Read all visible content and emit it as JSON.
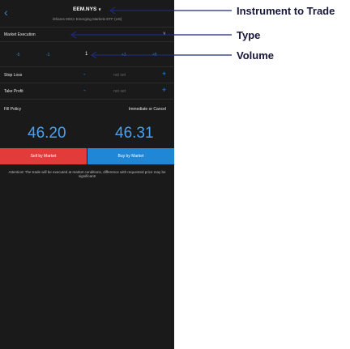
{
  "header": {
    "back_icon": "chevron-left-icon",
    "title": "EEM.NYS",
    "title_chevron": "∨",
    "subtitle": "iShares MSCI Emerging Markets ETF (US)"
  },
  "type_row": {
    "label": "Market Execution",
    "chevron": "∨"
  },
  "volume_row": {
    "steps_left": [
      "-5",
      "-1"
    ],
    "value": "1",
    "steps_right": [
      "+1",
      "+5"
    ]
  },
  "stop_loss": {
    "label": "Stop Loss",
    "minus": "-",
    "value": "not set",
    "plus": "+"
  },
  "take_profit": {
    "label": "Take Profit",
    "minus": "-",
    "value": "not set",
    "plus": "+"
  },
  "fill_policy": {
    "label": "Fill Policy",
    "value": "Immediate or Cancel"
  },
  "prices": {
    "sell": "46.20",
    "buy": "46.31"
  },
  "buttons": {
    "sell": "Sell by Market",
    "buy": "Buy by Market"
  },
  "note": "Attention! The trade will be executed at market conditions, difference with requested price may be significant!",
  "annotations": {
    "instrument": "Instrument to Trade",
    "type": "Type",
    "volume": "Volume"
  },
  "colors": {
    "background": "#1a1a1a",
    "accent": "#2f8be6",
    "sell_button": "#e33a3a",
    "buy_button": "#1f87d6",
    "price": "#4aa0f0",
    "annotation_text": "#16163a"
  }
}
